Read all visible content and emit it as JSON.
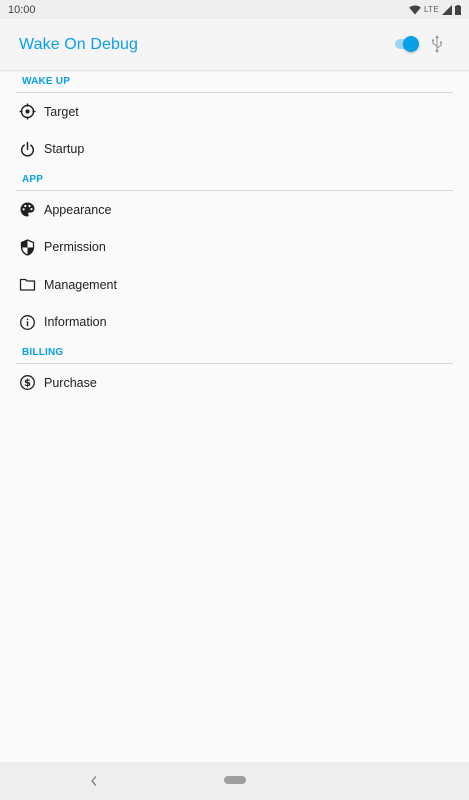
{
  "status_bar": {
    "time": "10:00",
    "network": "LTE"
  },
  "app_bar": {
    "title": "Wake On Debug",
    "toggle_on": true,
    "accent_color": "#0aa0e8"
  },
  "sections": [
    {
      "header": "WAKE UP",
      "items": [
        {
          "label": "Target",
          "icon": "target-crosshair-icon"
        },
        {
          "label": "Startup",
          "icon": "power-icon"
        }
      ]
    },
    {
      "header": "APP",
      "items": [
        {
          "label": "Appearance",
          "icon": "palette-icon"
        },
        {
          "label": "Permission",
          "icon": "shield-icon"
        },
        {
          "label": "Management",
          "icon": "folder-icon"
        },
        {
          "label": "Information",
          "icon": "info-icon"
        }
      ]
    },
    {
      "header": "BILLING",
      "items": [
        {
          "label": "Purchase",
          "icon": "dollar-circle-icon"
        }
      ]
    }
  ]
}
